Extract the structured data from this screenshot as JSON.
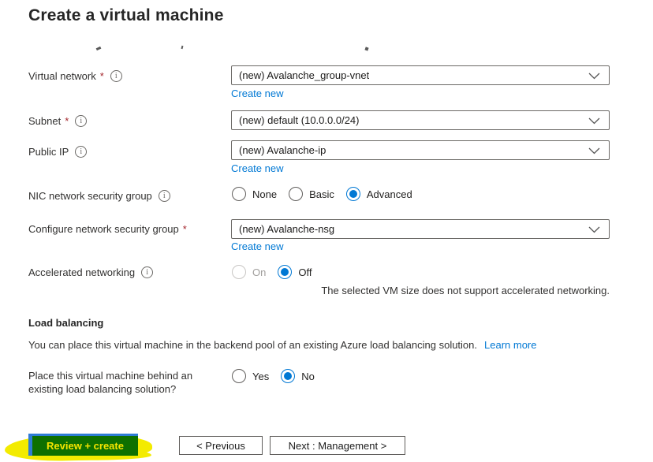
{
  "title": "Create a virtual machine",
  "colors": {
    "accent_blue": "#0078d4",
    "link_blue": "#0078d4",
    "required_red": "#a4262c",
    "highlighter_yellow": "#f3eb00",
    "highlighted_button_green": "#0e7000",
    "button_blue_edge": "#2e7cd4"
  },
  "fields": {
    "virtual_network": {
      "label": "Virtual network",
      "required": "*",
      "value": "(new) Avalanche_group-vnet",
      "create_new": "Create new"
    },
    "subnet": {
      "label": "Subnet",
      "required": "*",
      "value": "(new) default (10.0.0.0/24)"
    },
    "public_ip": {
      "label": "Public IP",
      "value": "(new) Avalanche-ip",
      "create_new": "Create new"
    },
    "nic_nsg": {
      "label": "NIC network security group",
      "options": [
        "None",
        "Basic",
        "Advanced"
      ],
      "selected": "Advanced"
    },
    "configure_nsg": {
      "label": "Configure network security group",
      "required": "*",
      "value": "(new) Avalanche-nsg",
      "create_new": "Create new"
    },
    "accelerated_networking": {
      "label": "Accelerated networking",
      "options": [
        "On",
        "Off"
      ],
      "selected": "Off",
      "disabled_option": "On",
      "note": "The selected VM size does not support accelerated networking."
    }
  },
  "load_balancing": {
    "heading": "Load balancing",
    "description": "You can place this virtual machine in the backend pool of an existing Azure load balancing solution.",
    "learn_more": "Learn more",
    "question": "Place this virtual machine behind an existing load balancing solution?",
    "options": [
      "Yes",
      "No"
    ],
    "selected": "No"
  },
  "footer": {
    "review_create": "Review + create",
    "previous": "< Previous",
    "next": "Next : Management >"
  }
}
